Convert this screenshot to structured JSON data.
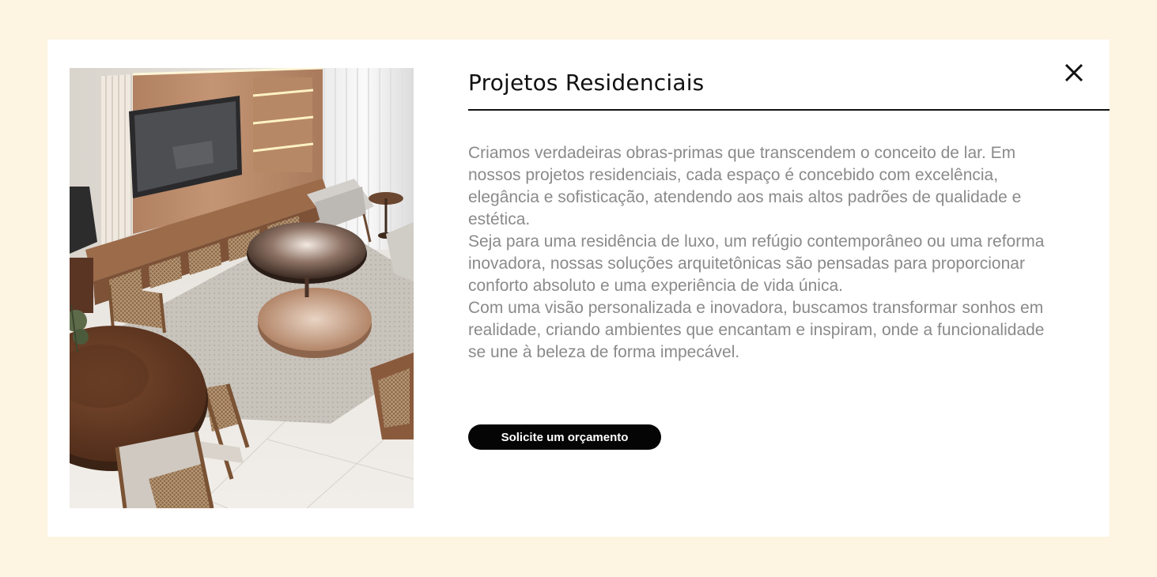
{
  "modal": {
    "title": "Projetos Residenciais",
    "paragraphs": [
      "Criamos verdadeiras obras-primas que transcendem o conceito de lar. Em nossos projetos residenciais, cada espaço é concebido com excelência, elegância e sofisticação, atendendo aos mais altos padrões de qualidade e estética.",
      "Seja para uma residência de luxo, um refúgio contemporâneo ou uma reforma inovadora, nossas soluções arquitetônicas são pensadas para proporcionar conforto absoluto e uma experiência de vida única.",
      "Com uma visão personalizada e inovadora, buscamos transformar sonhos em realidade, criando ambientes que encantam e inspiram, onde a funcionalidade se une à beleza de forma impecável."
    ],
    "cta_label": "Solicite um orçamento",
    "close_icon": "close-icon",
    "photo_subject": "living-room-interior-photo"
  },
  "colors": {
    "page_background": "#fdf4e1",
    "modal_background": "#ffffff",
    "title": "#111111",
    "body_text": "#8a8a8a",
    "button_background": "#050505",
    "button_text": "#ffffff"
  }
}
